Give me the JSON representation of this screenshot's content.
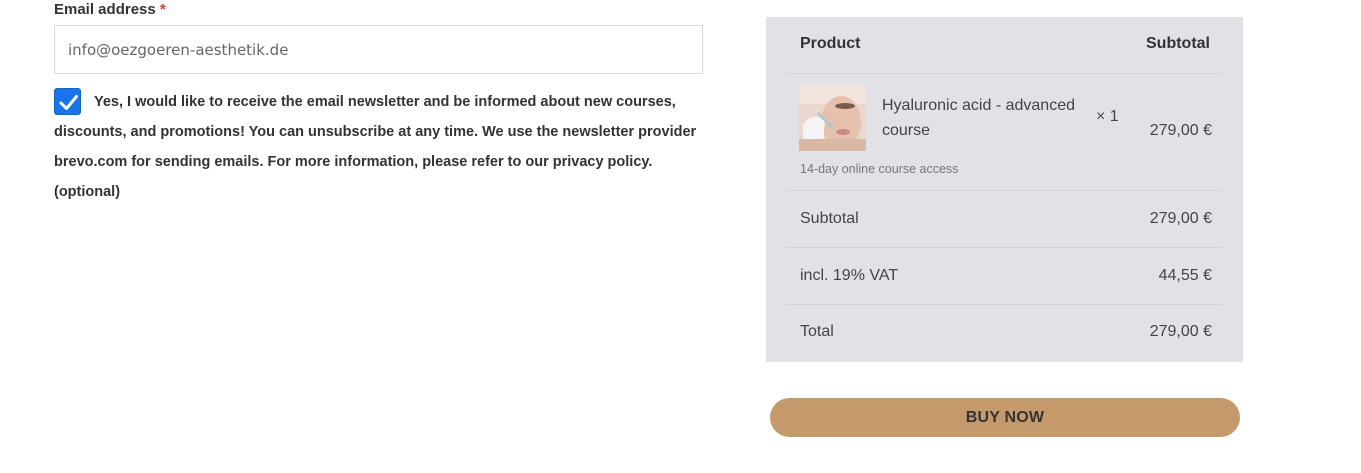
{
  "form": {
    "email_label": "Email address",
    "required_marker": "*",
    "email_value": "info@oezgoeren-aesthetik.de",
    "newsletter_checked": true,
    "newsletter_text": "Yes, I would like to receive the email newsletter and be informed about new courses, discounts, and promotions! You can unsubscribe at any time. We use the newsletter provider brevo.com for sending emails. For more information, please refer to our privacy policy. (optional)"
  },
  "order": {
    "header_product": "Product",
    "header_subtotal": "Subtotal",
    "item": {
      "name": "Hyaluronic acid - advanced course",
      "quantity": "× 1",
      "price": "279,00 €",
      "note": "14-day online course access",
      "thumbnail_icon": "product-photo"
    },
    "subtotal_label": "Subtotal",
    "subtotal_value": "279,00 €",
    "vat_label": "incl. 19% VAT",
    "vat_value": "44,55 €",
    "total_label": "Total",
    "total_value": "279,00 €"
  },
  "actions": {
    "buy_label": "BUY NOW"
  },
  "colors": {
    "accent_button": "#c49a6c",
    "checkbox": "#1a73e8",
    "summary_background": "#e2e2e6",
    "required": "#e2401c"
  }
}
